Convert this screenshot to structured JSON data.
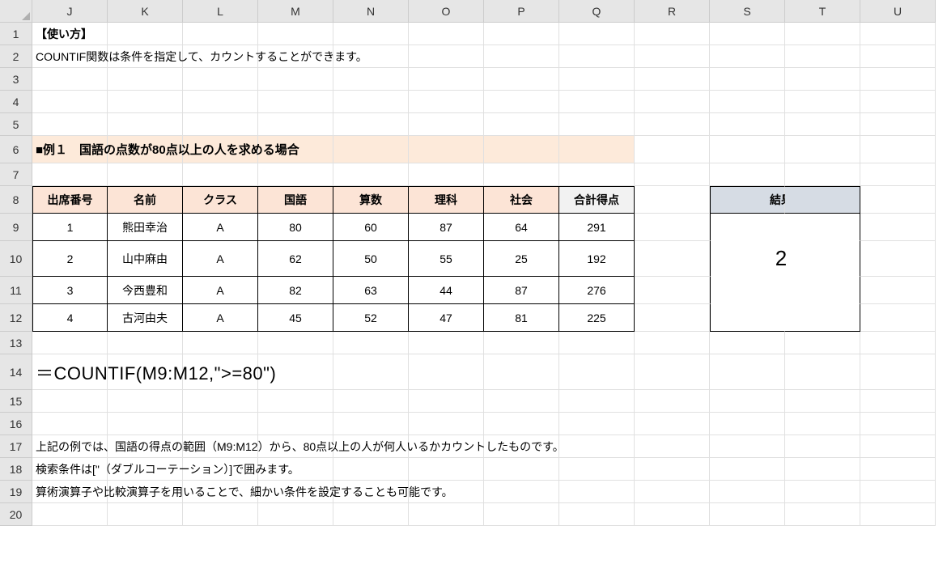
{
  "columns": [
    "J",
    "K",
    "L",
    "M",
    "N",
    "O",
    "P",
    "Q",
    "R",
    "S",
    "T",
    "U"
  ],
  "rows": [
    "1",
    "2",
    "3",
    "4",
    "5",
    "6",
    "7",
    "8",
    "9",
    "10",
    "11",
    "12",
    "13",
    "14",
    "15",
    "16",
    "17",
    "18",
    "19",
    "20"
  ],
  "rowHeights": {
    "6": 34,
    "8": 34,
    "9": 34,
    "10": 44,
    "11": 34,
    "12": 34,
    "14": 44
  },
  "text": {
    "usage_title": "【使い方】",
    "usage_desc": "COUNTIF関数は条件を指定して、カウントすることができます。",
    "example_title": "■例１　国語の点数が80点以上の人を求める場合",
    "hdr": {
      "no": "出席番号",
      "name": "名前",
      "class": "クラス",
      "kokugo": "国語",
      "sansu": "算数",
      "rika": "理科",
      "shakai": "社会",
      "total": "合計得点"
    },
    "data": [
      {
        "no": "1",
        "name": "熊田幸治",
        "class": "A",
        "kokugo": "80",
        "sansu": "60",
        "rika": "87",
        "shakai": "64",
        "total": "291"
      },
      {
        "no": "2",
        "name": "山中麻由",
        "class": "A",
        "kokugo": "62",
        "sansu": "50",
        "rika": "55",
        "shakai": "25",
        "total": "192"
      },
      {
        "no": "3",
        "name": "今西豊和",
        "class": "A",
        "kokugo": "82",
        "sansu": "63",
        "rika": "44",
        "shakai": "87",
        "total": "276"
      },
      {
        "no": "4",
        "name": "古河由夫",
        "class": "A",
        "kokugo": "45",
        "sansu": "52",
        "rika": "47",
        "shakai": "81",
        "total": "225"
      }
    ],
    "result_label": "結果",
    "result_value": "2",
    "formula": "＝COUNTIF(M9:M12,\">=80\")",
    "note1": "上記の例では、国語の得点の範囲（M9:M12）から、80点以上の人が何人いるかカウントしたものです。",
    "note2": "検索条件は[\"（ダブルコーテーション）]で囲みます。",
    "note3": "算術演算子や比較演算子を用いることで、細かい条件を設定することも可能です。"
  }
}
